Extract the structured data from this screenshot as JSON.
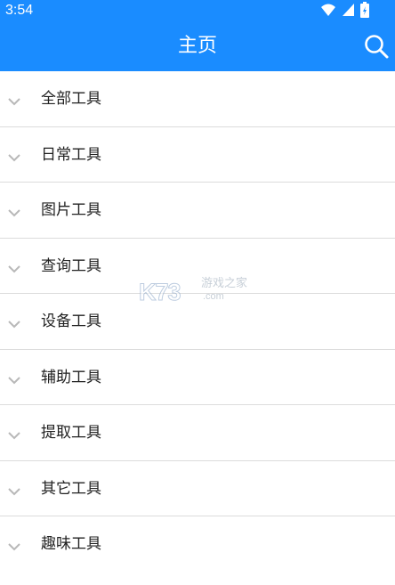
{
  "status_bar": {
    "time": "3:54",
    "icons": [
      "wifi-icon",
      "signal-icon",
      "battery-icon"
    ]
  },
  "app_bar": {
    "title": "主页",
    "search_icon": "search-icon",
    "color": "#1a8cff"
  },
  "categories": [
    {
      "label": "全部工具"
    },
    {
      "label": "日常工具"
    },
    {
      "label": "图片工具"
    },
    {
      "label": "查询工具"
    },
    {
      "label": "设备工具"
    },
    {
      "label": "辅助工具"
    },
    {
      "label": "提取工具"
    },
    {
      "label": "其它工具"
    },
    {
      "label": "趣味工具"
    }
  ],
  "watermark": {
    "logo": "K73",
    "cn": "游戏之家",
    "domain": ".com"
  }
}
